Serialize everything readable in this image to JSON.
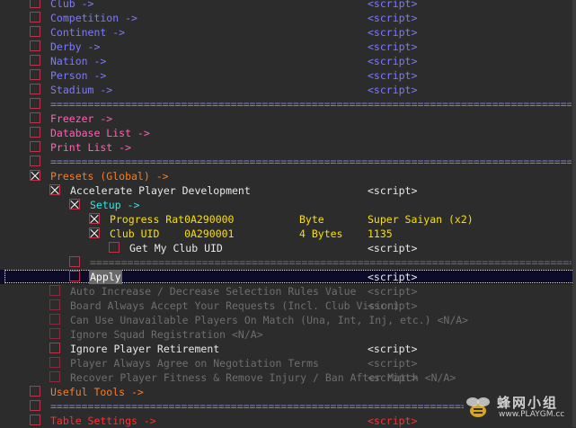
{
  "rows": [
    {
      "label": "Club ->",
      "script": "<script>"
    },
    {
      "label": "Competition ->",
      "script": "<script>"
    },
    {
      "label": "Continent ->",
      "script": "<script>"
    },
    {
      "label": "Derby ->",
      "script": "<script>"
    },
    {
      "label": "Nation ->",
      "script": "<script>"
    },
    {
      "label": "Person ->",
      "script": "<script>"
    },
    {
      "label": "Stadium ->",
      "script": "<script>"
    },
    {
      "label": "Freezer ->"
    },
    {
      "label": "Database List ->"
    },
    {
      "label": "Print List ->"
    },
    {
      "label": "Presets (Global) ->"
    },
    {
      "label": "Accelerate Player Development",
      "script": "<script>"
    },
    {
      "label": "Setup ->"
    },
    {
      "label": "Progress Rat0A290000",
      "type": "Byte",
      "value": "Super Saiyan (x2)"
    },
    {
      "label": "Club UID    0A290001",
      "type": "4 Bytes",
      "value": "1135"
    },
    {
      "label": "Get My Club UID",
      "script": "<script>"
    },
    {
      "label": "Apply",
      "script": "<script>"
    },
    {
      "label": "Auto Increase / Decrease Selection Rules Value",
      "script": "<script>"
    },
    {
      "label": "Board Always Accept Your Requests (Incl. Club Vision)",
      "script": "<script>"
    },
    {
      "label": "Can Use Unavailable Players On Match (Una, Int, Inj, etc.) <N/A>"
    },
    {
      "label": "Ignore Squad Registration <N/A>"
    },
    {
      "label": "Ignore Player Retirement",
      "script": "<script>"
    },
    {
      "label": "Player Always Agree on Negotiation Terms",
      "script": "<script>"
    },
    {
      "label": "Recover Player Fitness & Remove Injury / Ban After Match <N/A>",
      "script": "<script>"
    },
    {
      "label": "Useful Tools ->"
    },
    {
      "label": "Table Settings ->",
      "script": "<script>"
    }
  ],
  "separators": {
    "line": "=================================================================================================="
  },
  "watermark": {
    "name": "蜂网小组",
    "url": "www.PLAYGM.cc"
  },
  "colors": {
    "checkbox": "#c0324a",
    "selection_bg": "#0c0c2a",
    "background": "#2c2c2c"
  }
}
